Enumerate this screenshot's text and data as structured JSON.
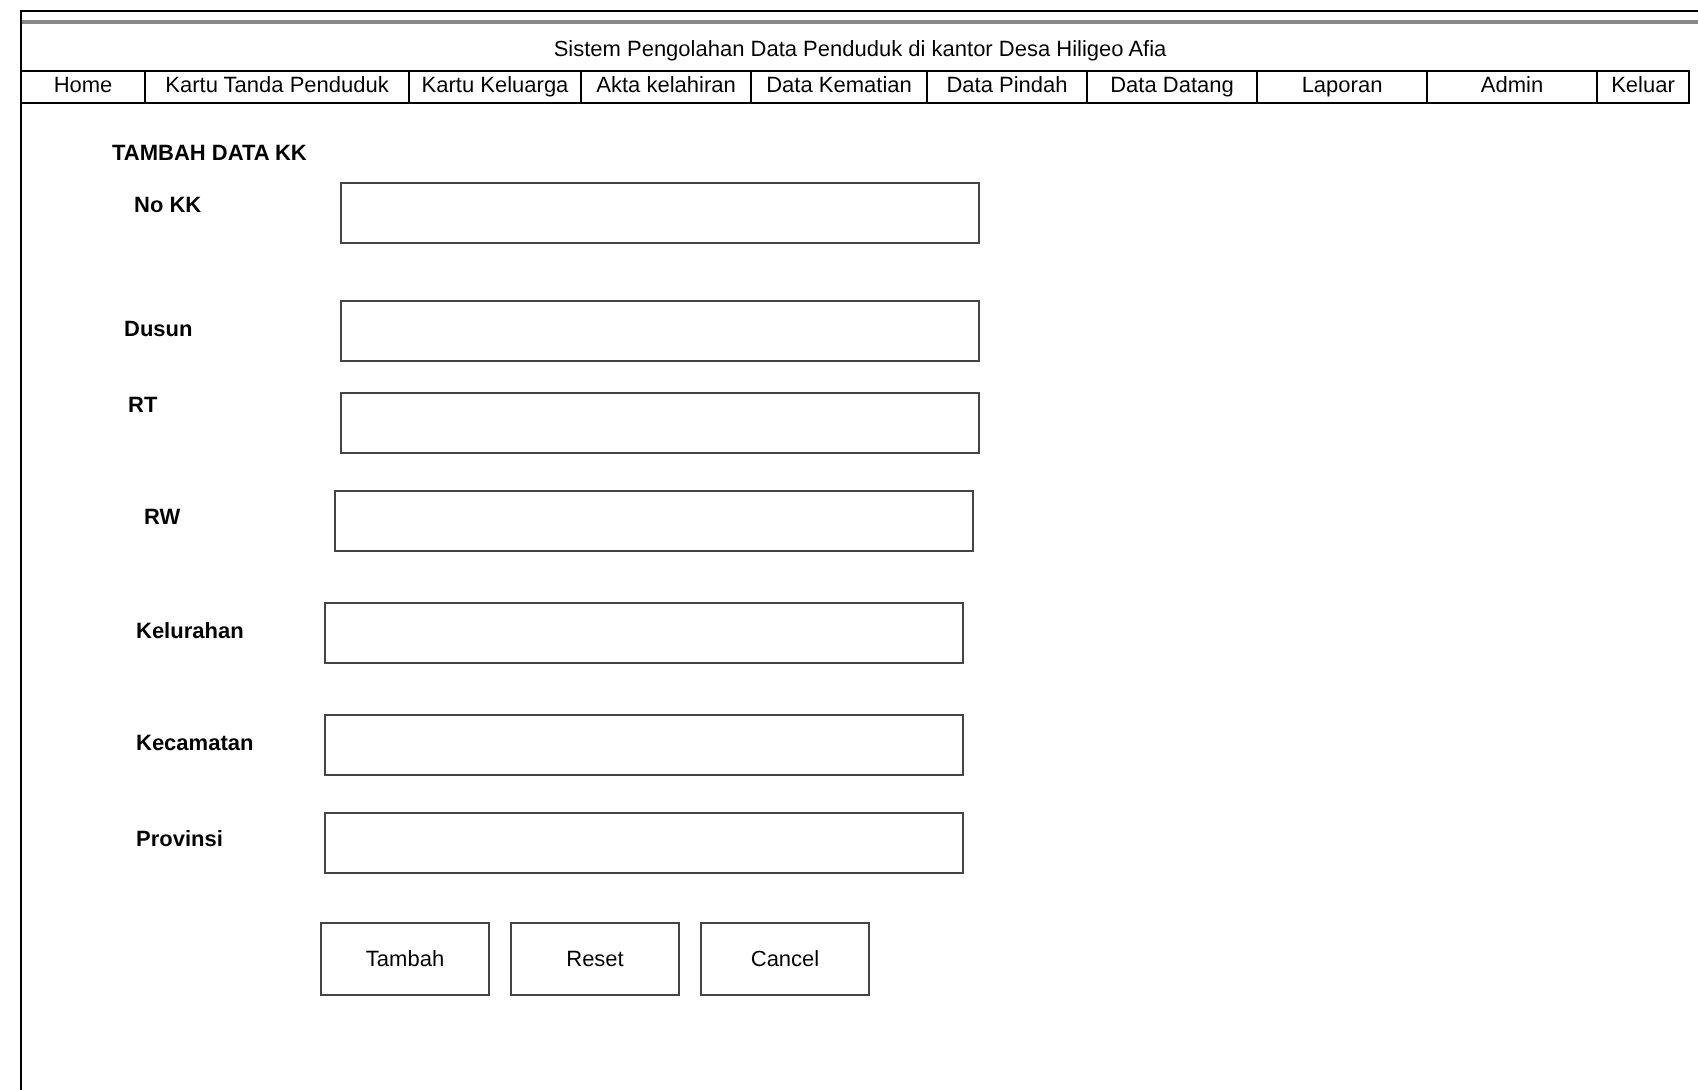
{
  "title": "Sistem Pengolahan Data Penduduk di kantor Desa Hiligeo Afia",
  "nav": [
    {
      "label": "Home"
    },
    {
      "label": "Kartu Tanda Penduduk"
    },
    {
      "label": "Kartu Keluarga"
    },
    {
      "label": "Akta kelahiran"
    },
    {
      "label": "Data Kematian"
    },
    {
      "label": "Data Pindah"
    },
    {
      "label": "Data Datang"
    },
    {
      "label": "Laporan"
    },
    {
      "label": "Admin"
    },
    {
      "label": "Keluar"
    }
  ],
  "form": {
    "heading": "TAMBAH DATA KK",
    "fields": [
      {
        "label": "No KK"
      },
      {
        "label": "Dusun"
      },
      {
        "label": "RT"
      },
      {
        "label": "RW"
      },
      {
        "label": "Kelurahan"
      },
      {
        "label": "Kecamatan"
      },
      {
        "label": "Provinsi"
      }
    ],
    "buttons": [
      "Tambah",
      "Reset",
      "Cancel"
    ]
  }
}
